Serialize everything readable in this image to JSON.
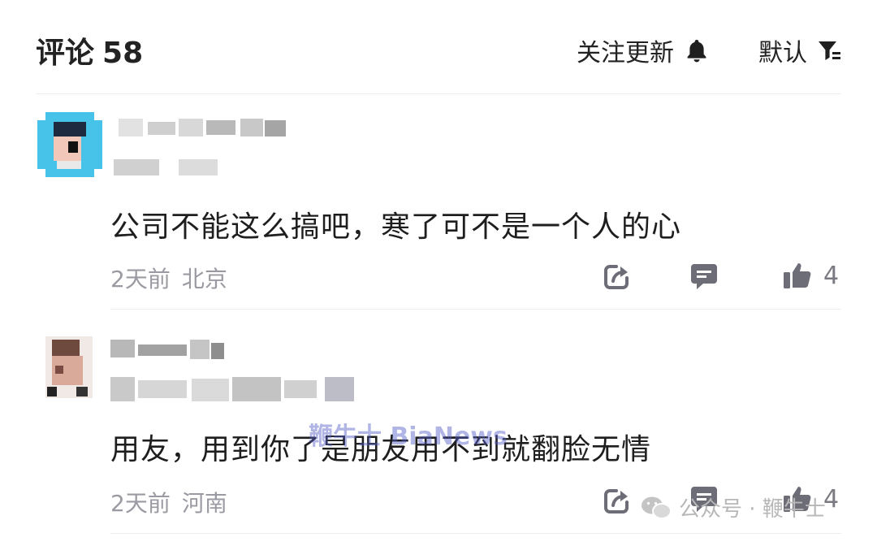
{
  "header": {
    "title": "评论",
    "count": "58",
    "follow_label": "关注更新",
    "sort_label": "默认",
    "icons": {
      "follow": "bell-icon",
      "sort": "filter-icon"
    }
  },
  "comments": [
    {
      "text": "公司不能这么搞吧，寒了可不是一个人的心",
      "time": "2天前",
      "location": "北京",
      "likes": "4"
    },
    {
      "text": "用友，用到你了是朋友用不到就翻脸无情",
      "time": "2天前",
      "location": "河南",
      "likes": "4"
    }
  ],
  "watermark": "鞭牛士 BiaNews",
  "brand": "公众号 · 鞭牛士",
  "colors": {
    "meta": "#9a9aa2",
    "icon": "#6d6d78",
    "text": "#1e1e1e"
  }
}
